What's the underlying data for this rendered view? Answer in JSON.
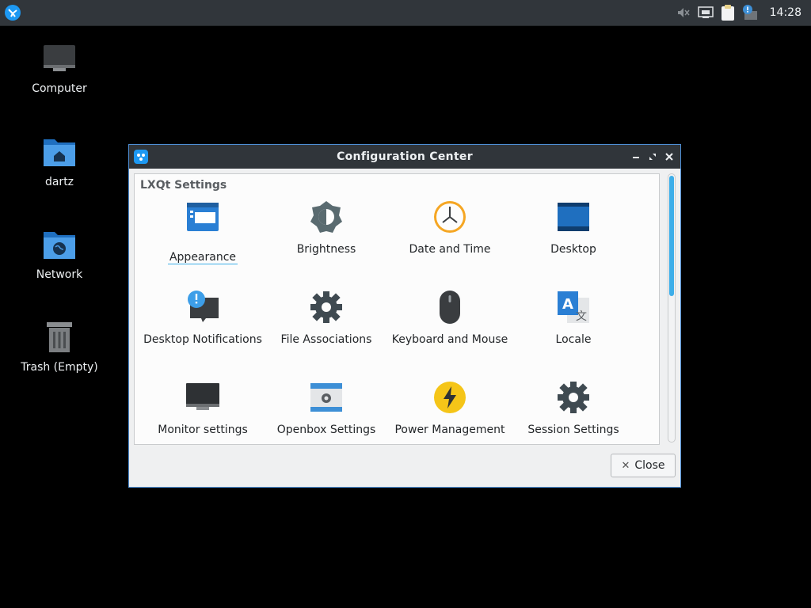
{
  "panel": {
    "menu_icon": "lxqt-menu-icon",
    "tray_icons": [
      "volume-muted-icon",
      "network-icon",
      "clipboard-icon",
      "notification-icon"
    ],
    "clock": "14:28"
  },
  "desktop": {
    "icons": [
      {
        "label": "Computer",
        "icon": "computer-icon"
      },
      {
        "label": "dartz",
        "icon": "home-folder-icon"
      },
      {
        "label": "Network",
        "icon": "network-folder-icon"
      },
      {
        "label": "Trash (Empty)",
        "icon": "trash-icon"
      }
    ]
  },
  "window": {
    "title": "Configuration Center",
    "section": "LXQt Settings",
    "items": [
      {
        "label": "Appearance",
        "icon": "appearance-icon"
      },
      {
        "label": "Brightness",
        "icon": "brightness-icon"
      },
      {
        "label": "Date and Time",
        "icon": "clock-icon"
      },
      {
        "label": "Desktop",
        "icon": "desktop-icon"
      },
      {
        "label": "Desktop Notifications",
        "icon": "notifications-icon"
      },
      {
        "label": "File Associations",
        "icon": "gear-icon"
      },
      {
        "label": "Keyboard and Mouse",
        "icon": "mouse-icon"
      },
      {
        "label": "Locale",
        "icon": "locale-icon"
      },
      {
        "label": "Monitor settings",
        "icon": "monitor-icon"
      },
      {
        "label": "Openbox Settings",
        "icon": "openbox-icon"
      },
      {
        "label": "Power Management",
        "icon": "power-icon"
      },
      {
        "label": "Session Settings",
        "icon": "gear-icon"
      }
    ],
    "close_label": "Close"
  },
  "colors": {
    "accent": "#3daee9",
    "titlebar": "#30353a",
    "panel": "#31363b"
  }
}
